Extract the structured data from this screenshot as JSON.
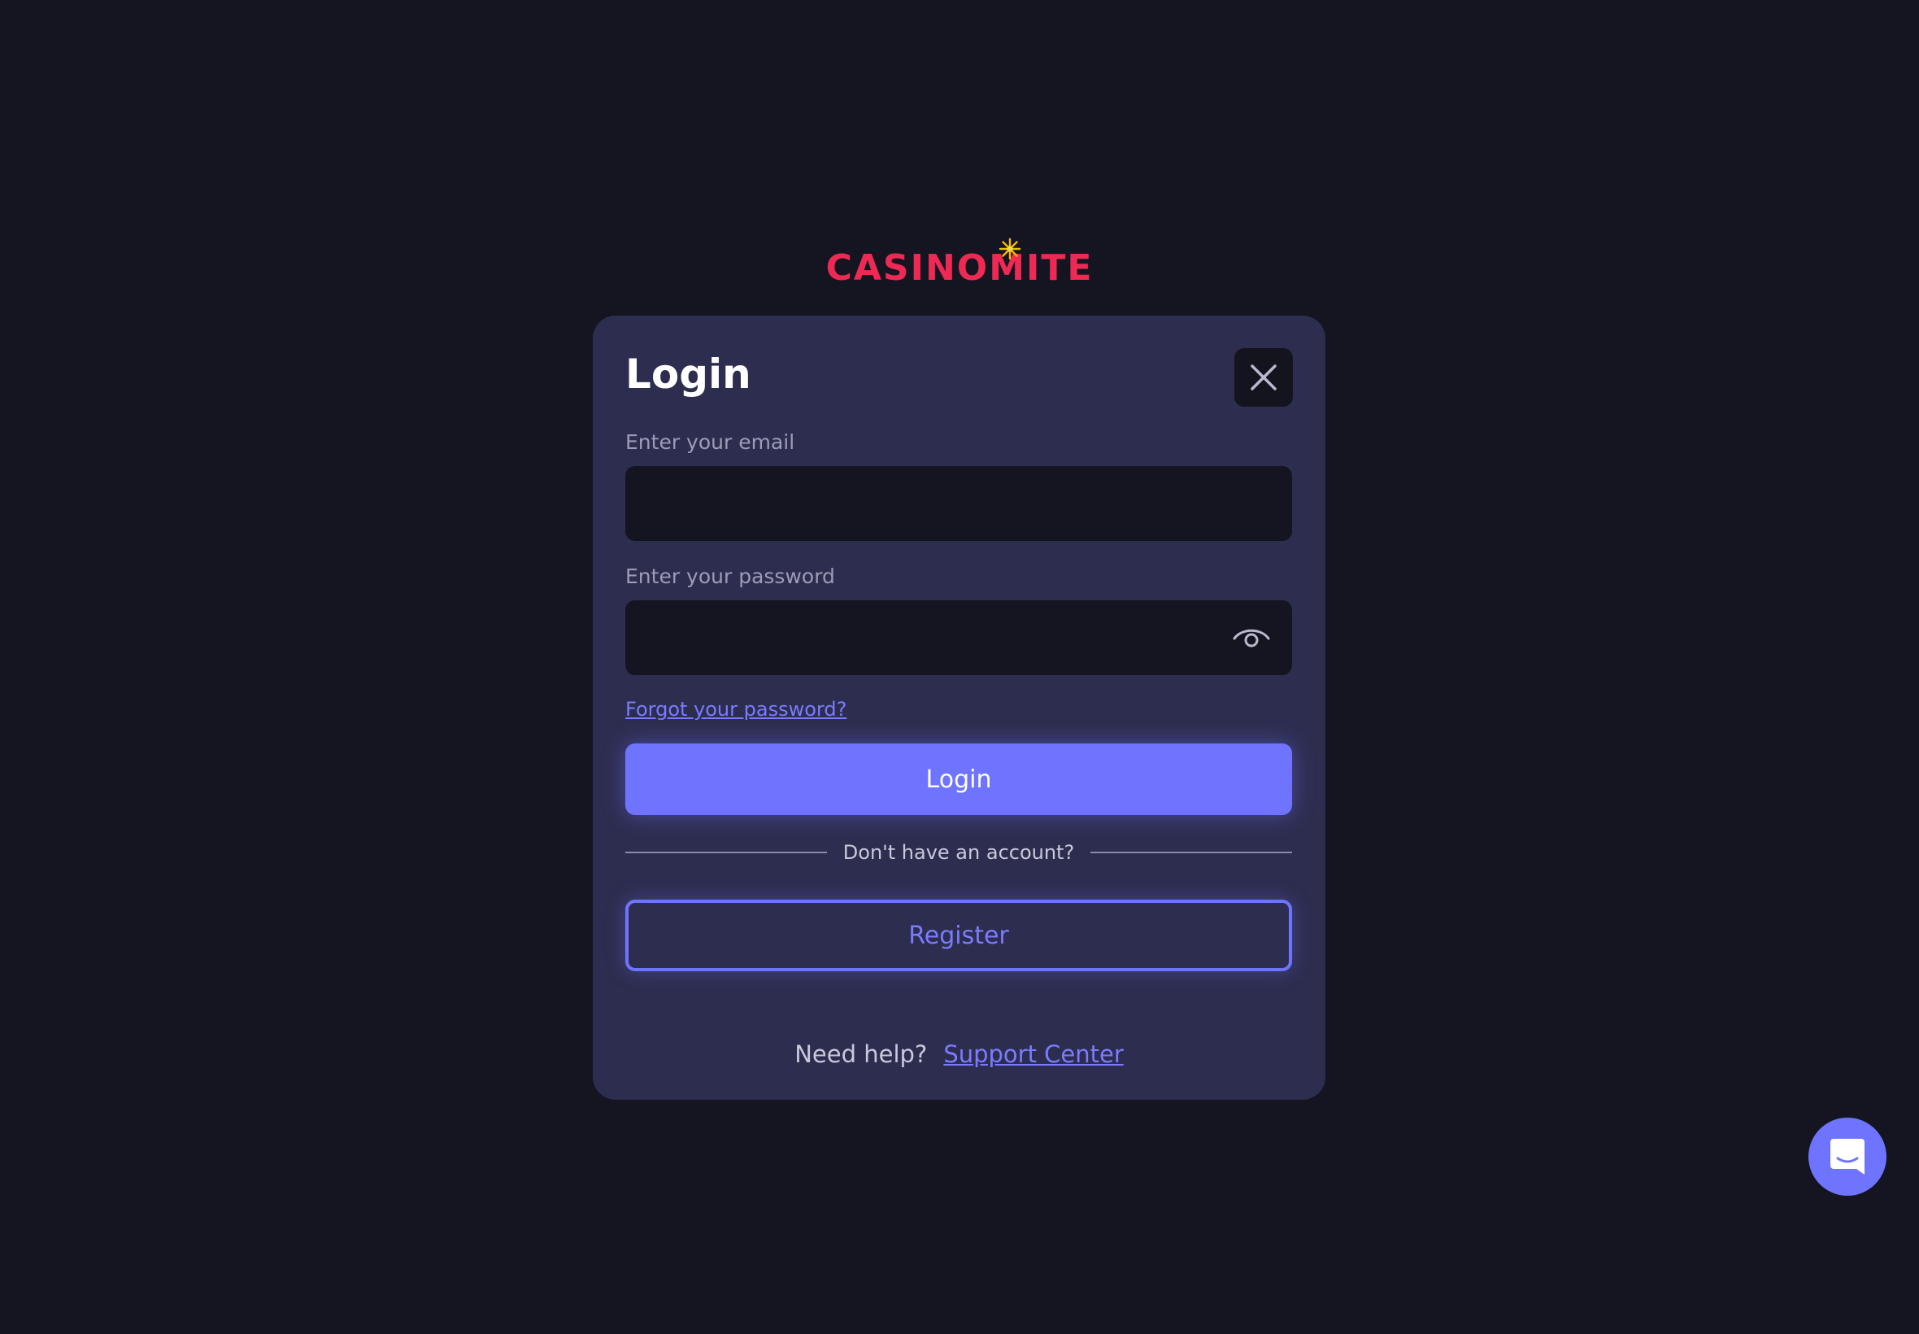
{
  "brand": {
    "logo_text": "CASINOMITE"
  },
  "login_modal": {
    "title": "Login",
    "email": {
      "label": "Enter your email",
      "value": ""
    },
    "password": {
      "label": "Enter your password",
      "value": ""
    },
    "forgot_password_link": "Forgot your password?",
    "login_button": "Login",
    "divider_text": "Don't have an account?",
    "register_button": "Register",
    "help_text": "Need help?",
    "support_link": "Support Center"
  },
  "icons": {
    "close": "close-icon",
    "show_password": "eye-icon",
    "chat": "chat-icon",
    "logo_spark": "spark-icon"
  },
  "colors": {
    "background": "#141521",
    "modal": "#2d2d4f",
    "accent": "#6f74ff",
    "brand_red": "#ee2a54",
    "spark": "#f5b800"
  }
}
